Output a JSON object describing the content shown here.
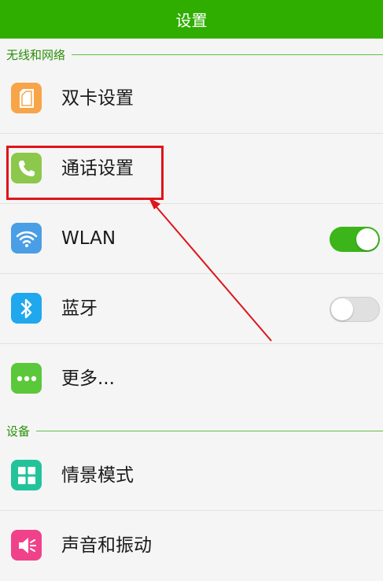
{
  "header": {
    "title": "设置",
    "bg_color": "#2fae00"
  },
  "sections": [
    {
      "label": "无线和网络"
    },
    {
      "label": "设备"
    }
  ],
  "items": [
    {
      "label": "双卡设置",
      "icon": "sim-card-icon",
      "icon_color": "#f7a548"
    },
    {
      "label": "通话设置",
      "icon": "phone-icon",
      "icon_color": "#8cc84b"
    },
    {
      "label": "WLAN",
      "icon": "wifi-icon",
      "icon_color": "#4a9ee5",
      "toggle": "on"
    },
    {
      "label": "蓝牙",
      "icon": "bluetooth-icon",
      "icon_color": "#1fa8ee",
      "toggle": "off"
    },
    {
      "label": "更多...",
      "icon": "more-dots-icon",
      "icon_color": "#5ac83a"
    },
    {
      "label": "情景模式",
      "icon": "grid-icon",
      "icon_color": "#23c39a"
    },
    {
      "label": "声音和振动",
      "icon": "speaker-icon",
      "icon_color": "#f0428a"
    }
  ],
  "annotation": {
    "color": "#e0141a"
  }
}
